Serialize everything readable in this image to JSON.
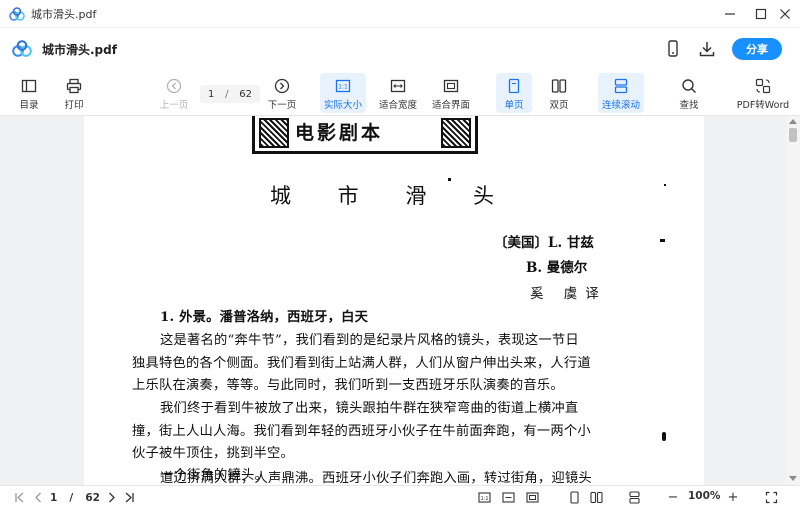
{
  "window": {
    "title": "城市滑头.pdf",
    "controls": [
      "minimize-icon",
      "maximize-icon",
      "close-icon"
    ]
  },
  "header": {
    "doc_title": "城市滑头.pdf",
    "share_label": "分享",
    "brand_color": "#1890ff"
  },
  "toolbar": {
    "toc": "目录",
    "print": "打印",
    "prev_page": "上一页",
    "current_page": "1",
    "page_sep": "/",
    "total_pages": "62",
    "next_page": "下一页",
    "actual_size": "实际大小",
    "fit_width": "适合宽度",
    "fit_page": "适合界面",
    "single_page": "单页",
    "double_page": "双页",
    "continuous_scroll": "连续滚动",
    "search": "查找",
    "pdf_to_word": "PDF转Word",
    "active_color": "#1a73e8"
  },
  "document": {
    "banner": "电影剧本",
    "title": "城 市 滑 头",
    "author_1": "〔美国〕L. 甘兹",
    "author_2": "B. 曼德尔",
    "translator": "奚 虞译",
    "scene_heading": "1. 外景。潘普洛纳，西班牙，白天",
    "lines": [
      "这是著名的“奔牛节”，我们看到的是纪录片风格的镜头，表现这一节日",
      "独具特色的各个侧面。我们看到街上站满人群，人们从窗户伸出头来，人行道",
      "上乐队在演奏，等等。与此同时，我们听到一支西班牙乐队演奏的音乐。",
      "我们终于看到牛被放了出来，镜头跟拍牛群在狭窄弯曲的街道上横冲直",
      "撞，街上人山人海。我们看到年轻的西班牙小伙子在牛前面奔跑，有一两个小",
      "伙子被牛顶住，挑到半空。",
      "一个街角的镜头。",
      "道边挤满人群，人声鼎沸。西班牙小伙子们奔跑入画，转过街角，迎镜头"
    ]
  },
  "bottombar": {
    "current_page": "1",
    "page_sep": "/",
    "total_pages": "62",
    "zoom_minus": "−",
    "zoom": "100%",
    "zoom_plus": "+"
  }
}
